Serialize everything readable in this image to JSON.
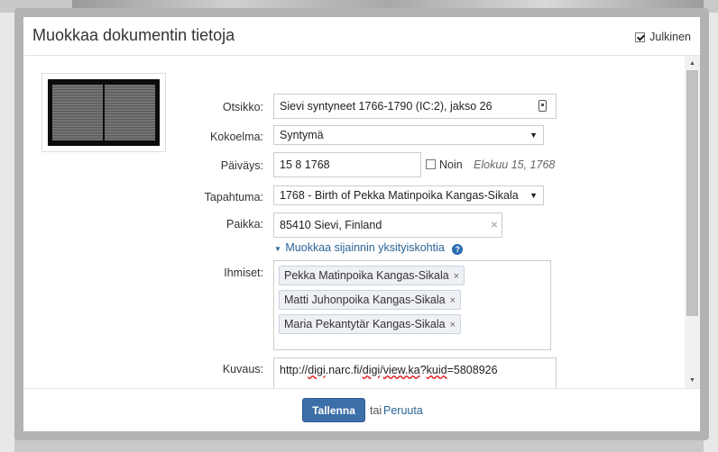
{
  "dialog": {
    "title": "Muokkaa dokumentin tietoja",
    "public_label": "Julkinen",
    "public_checked": true
  },
  "form": {
    "title_label": "Otsikko:",
    "title_value": "Sievi syntyneet 1766-1790 (IC:2), jakso 26",
    "collection_label": "Kokoelma:",
    "collection_value": "Syntymä",
    "date_label": "Päiväys:",
    "date_value": "15 8 1768",
    "approx_label": "Noin",
    "date_hint": "Elokuu 15, 1768",
    "event_label": "Tapahtuma:",
    "event_value": "1768 - Birth of Pekka Matinpoika Kangas-Sikala",
    "place_label": "Paikka:",
    "place_value": "85410 Sievi, Finland",
    "place_clear": "×",
    "place_details_link": "Muokkaa sijainnin yksityiskohtia",
    "help_glyph": "?",
    "people_label": "Ihmiset:",
    "people": [
      "Pekka Matinpoika Kangas-Sikala",
      "Matti Juhonpoika Kangas-Sikala",
      "Maria Pekantytär Kangas-Sikala"
    ],
    "tag_remove": "×",
    "description_label": "Kuvaus:",
    "description_value": {
      "p1": "http://",
      "p2": "digi",
      "p3": ".narc.fi/",
      "p4": "digi",
      "p5": "/",
      "p6": "view.ka",
      "p7": "?",
      "p8": "kuid",
      "p9": "=5808926"
    }
  },
  "footer": {
    "save_label": "Tallenna",
    "or_text": "tai",
    "cancel_label": "Peruuta"
  },
  "icons": {
    "calendar_field": "bookmark-icon",
    "select_arrow": "caret-down-icon"
  },
  "colors": {
    "primary": "#3c6ea8",
    "link": "#2a6496",
    "tag_bg": "#eef0f5"
  }
}
